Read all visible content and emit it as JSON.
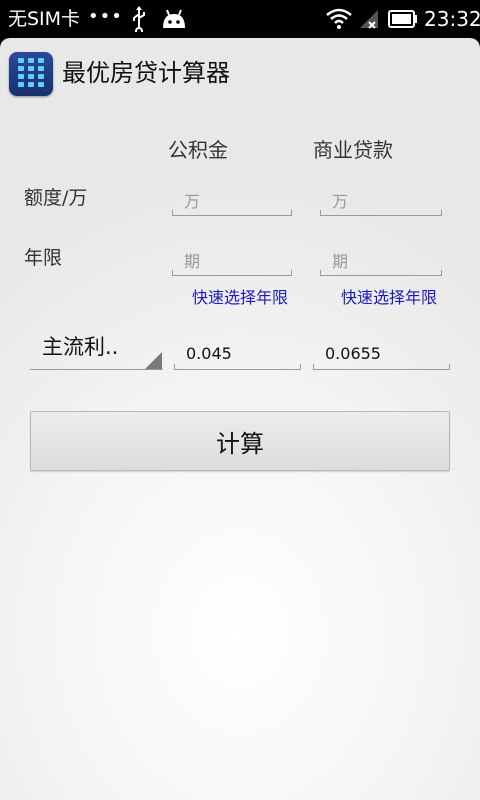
{
  "status_bar": {
    "carrier": "无SIM卡",
    "dots": "•••",
    "time": "23:32",
    "icons": [
      "usb-icon",
      "android-icon",
      "wifi-icon",
      "signal-icon",
      "battery-icon"
    ]
  },
  "app": {
    "title": "最优房贷计算器",
    "icon": "calculator-icon"
  },
  "form": {
    "columns": {
      "fund": "公积金",
      "commercial": "商业贷款"
    },
    "rows": {
      "amount_label": "额度/万",
      "years_label": "年限"
    },
    "fund_amount": {
      "value": "",
      "placeholder": "万"
    },
    "commercial_amount": {
      "value": "",
      "placeholder": "万"
    },
    "fund_years": {
      "value": "",
      "placeholder": "期"
    },
    "commercial_years": {
      "value": "",
      "placeholder": "期"
    },
    "quick_select_fund": "快速选择年限",
    "quick_select_commercial": "快速选择年限",
    "rate_spinner": "主流利..",
    "fund_rate": "0.045",
    "commercial_rate": "0.0655",
    "calculate_button": "计算"
  },
  "colors": {
    "link": "#1a1aba",
    "status_bar_bg": "#000000",
    "icon_bg": "#1f3d86",
    "icon_keys": "#5fd0ff"
  }
}
